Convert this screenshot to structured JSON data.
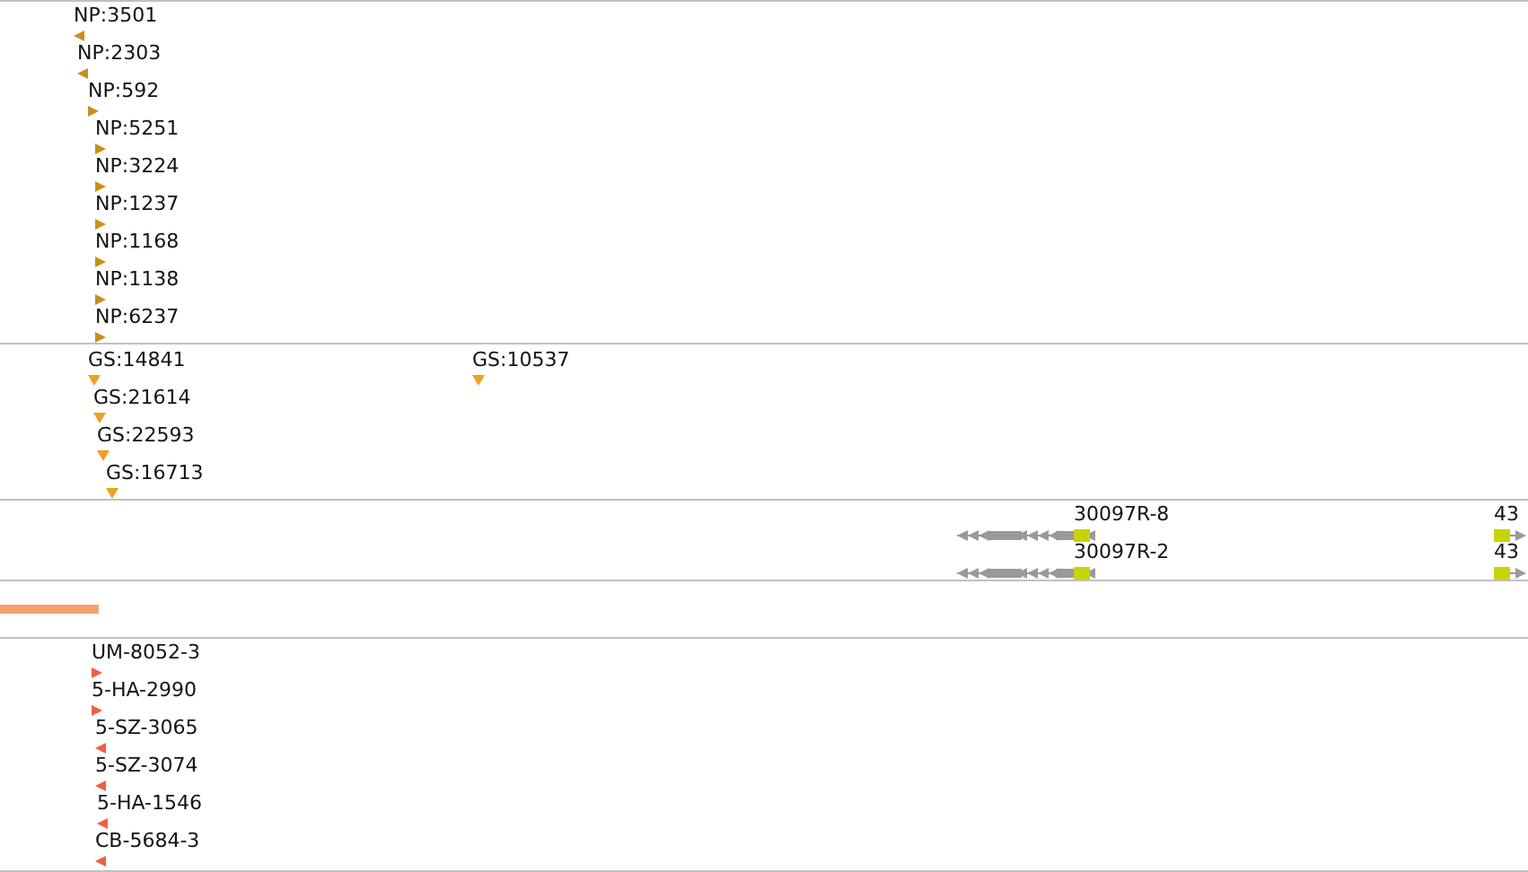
{
  "tracks": [
    {
      "kind": "markers",
      "color": "#c8901a",
      "features": [
        {
          "label": "NP:3501",
          "kind": "left"
        },
        {
          "label": "NP:2303",
          "kind": "left"
        },
        {
          "label": "NP:592",
          "kind": "right"
        },
        {
          "label": "NP:5251",
          "kind": "right"
        },
        {
          "label": "NP:3224",
          "kind": "right"
        },
        {
          "label": "NP:1237",
          "kind": "right"
        },
        {
          "label": "NP:1168",
          "kind": "right"
        },
        {
          "label": "NP:1138",
          "kind": "right"
        },
        {
          "label": "NP:6237",
          "kind": "right"
        }
      ]
    },
    {
      "kind": "markers",
      "color": "#f0a020",
      "features": [
        {
          "label": "GS:14841",
          "kind": "down"
        },
        {
          "label": "GS:10537",
          "kind": "down"
        },
        {
          "label": "GS:21614",
          "kind": "down"
        },
        {
          "label": "GS:22593",
          "kind": "down"
        },
        {
          "label": "GS:16713",
          "kind": "down"
        }
      ]
    },
    {
      "kind": "genes",
      "color": "#c8d400",
      "features": [
        {
          "label": "30097R-8",
          "kind": "left"
        },
        {
          "label": "43",
          "kind": "right"
        },
        {
          "label": "30097R-2",
          "kind": "left"
        },
        {
          "label": "43",
          "kind": "right"
        }
      ]
    },
    {
      "kind": "bar",
      "color": "#f5a070"
    },
    {
      "kind": "markers",
      "color": "#f06040",
      "features": [
        {
          "label": "UM-8052-3",
          "kind": "right"
        },
        {
          "label": "5-HA-2990",
          "kind": "right"
        },
        {
          "label": "5-SZ-3065",
          "kind": "left"
        },
        {
          "label": "5-SZ-3074",
          "kind": "left"
        },
        {
          "label": "5-HA-1546",
          "kind": "left"
        },
        {
          "label": "CB-5684-3",
          "kind": "left"
        }
      ]
    }
  ]
}
